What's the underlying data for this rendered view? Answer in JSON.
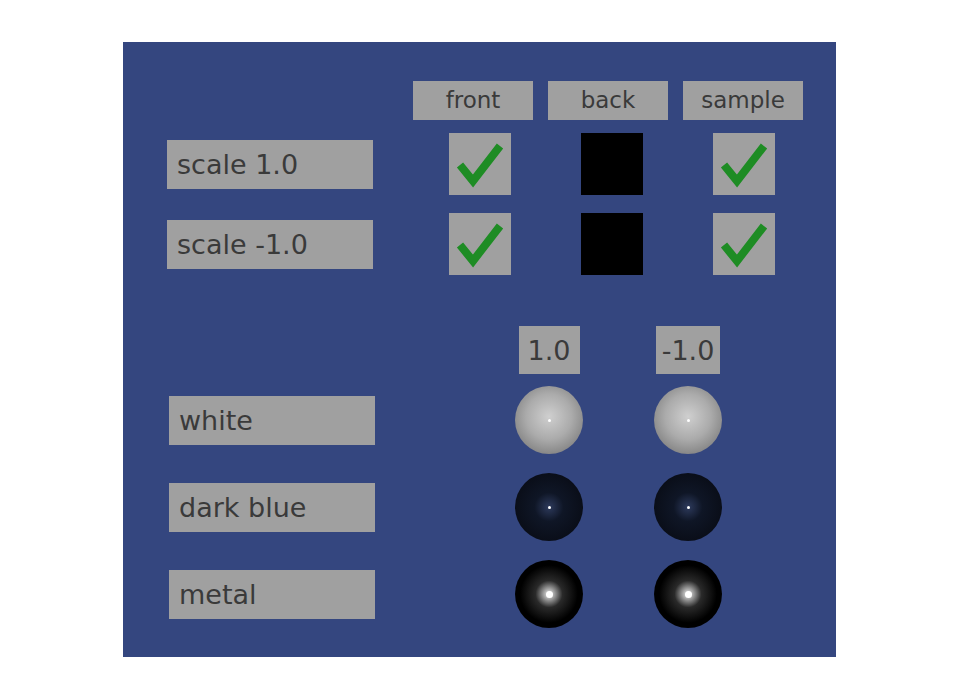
{
  "columns": [
    {
      "label": "front"
    },
    {
      "label": "back"
    },
    {
      "label": "sample"
    }
  ],
  "scale_rows": [
    {
      "label": "scale 1.0",
      "cells": [
        {
          "checked": true
        },
        {
          "checked": false
        },
        {
          "checked": true
        }
      ]
    },
    {
      "label": "scale -1.0",
      "cells": [
        {
          "checked": true
        },
        {
          "checked": false
        },
        {
          "checked": true
        }
      ]
    }
  ],
  "material_columns": [
    {
      "label": "1.0"
    },
    {
      "label": "-1.0"
    }
  ],
  "material_rows": [
    {
      "label": "white",
      "kind": "white"
    },
    {
      "label": "dark blue",
      "kind": "darkblue"
    },
    {
      "label": "metal",
      "kind": "metal"
    }
  ]
}
